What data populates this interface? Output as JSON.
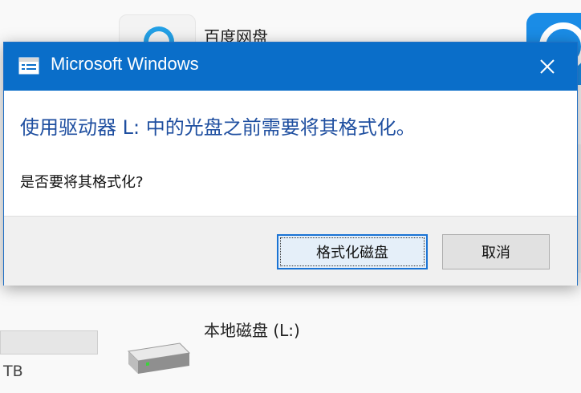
{
  "background": {
    "app_label": "百度网盘",
    "drive_label": "本地磁盘 (L:)",
    "size_text": "TB"
  },
  "dialog": {
    "title": "Microsoft Windows",
    "main_instruction": "使用驱动器 L: 中的光盘之前需要将其格式化。",
    "sub_instruction": "是否要将其格式化?",
    "primary_button": "格式化磁盘",
    "cancel_button": "取消"
  },
  "colors": {
    "titlebar": "#0a6ec9",
    "instruction": "#1f4fa0",
    "accent": "#1a73d4"
  },
  "icons": {
    "title_icon": "window-app-icon",
    "close_icon": "close-icon",
    "drive_icon": "hard-drive-icon"
  }
}
